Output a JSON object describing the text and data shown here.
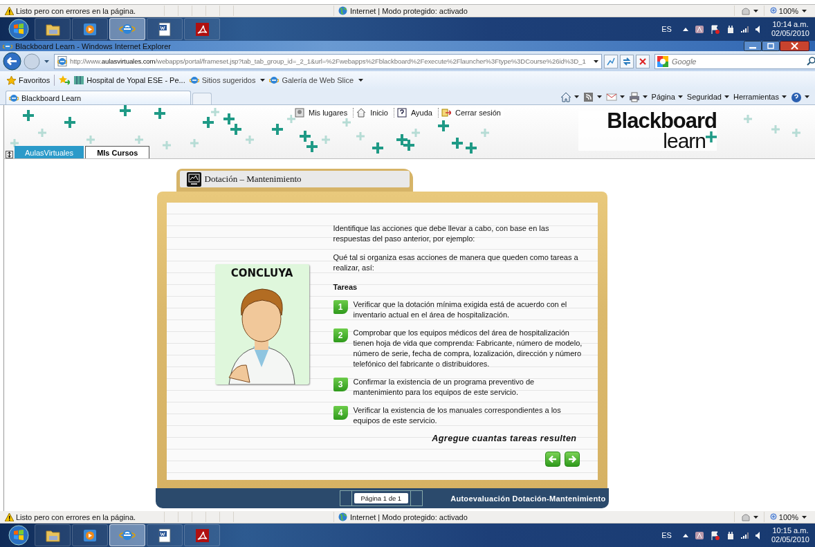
{
  "top_status_bar": {
    "message": "Listo pero con errores en la página.",
    "zone": "Internet | Modo protegido: activado",
    "zoom": "100%"
  },
  "top_taskbar": {
    "apps": [
      {
        "kind": "folder",
        "selected": false
      },
      {
        "kind": "media",
        "selected": false
      },
      {
        "kind": "browser",
        "selected": true
      },
      {
        "kind": "word",
        "selected": false
      },
      {
        "kind": "pdf",
        "selected": false
      }
    ],
    "language": "ES",
    "time": "10:14 a.m.",
    "date": "02/05/2010"
  },
  "browser": {
    "title": "Blackboard Learn - Windows Internet Explorer",
    "address": "http://www.**aulasvirtuales.com**/webapps/portal/frameset.jsp?tab_tab_group_id=_2_1&url=%2Fwebapps%2Fblackboard%2Fexecute%2Flauncher%3Ftype%3DCourse%26id%3D_1",
    "search": {
      "placeholder": "Google"
    },
    "favorites_label": "Favoritos",
    "favorites": [
      {
        "label": "Hospital de Yopal ESE - Pe...",
        "kind": "site"
      },
      {
        "label": "Sitios sugeridos",
        "kind": "menu"
      },
      {
        "label": "Galería de Web Slice",
        "kind": "menu"
      }
    ],
    "tab": {
      "label": "Blackboard Learn"
    },
    "commands": [
      "Página",
      "Seguridad",
      "Herramientas"
    ]
  },
  "portal": {
    "links": [
      {
        "label": "Mis lugares",
        "kind": "places"
      },
      {
        "label": "Inicio",
        "kind": "home"
      },
      {
        "label": "Ayuda",
        "kind": "help"
      },
      {
        "label": "Cerrar sesión",
        "kind": "logout"
      }
    ],
    "logo": {
      "top": "Blackboard",
      "bottom": "learn"
    },
    "tabs": [
      {
        "label": "AulasVirtuales",
        "selected": false
      },
      {
        "label": "MIs Cursos",
        "selected": true
      }
    ]
  },
  "lesson": {
    "title": "Dotación – Mantenimiento",
    "heading": "CONCLUYA",
    "paragraphs": [
      "Identifique las acciones que debe llevar a cabo, con base en las respuestas del paso anterior, por ejemplo:",
      "Qué tal si organiza esas acciones de manera que queden como tareas a realizar, así:"
    ],
    "tasks_heading": "Tareas",
    "tasks": [
      {
        "number": "1",
        "text": "Verificar que la dotación mínima exigida está de acuerdo con el inventario actual en el área de hospitalización."
      },
      {
        "number": "2",
        "text": "Comprobar que los equipos médicos del área de hospitalización tienen hoja de vida que comprenda: Fabricante, número de modelo, número de serie, fecha de compra, lozalización, dirección y número telefónico del fabricante o distribuidores."
      },
      {
        "number": "3",
        "text": "Confirmar la existencia de un programa preventivo de mantenimiento para los equipos de este servicio."
      },
      {
        "number": "4",
        "text": "Verificar la existencia de los manuales correspondientes a los equipos de este servicio."
      }
    ],
    "closing": "Agregue cuantas tareas resulten",
    "page_label": "Página 1 de 1",
    "footer_title": "Autoevaluación Dotación-Mantenimiento"
  },
  "bottom_status_bar": {
    "message": "Listo pero con errores en la página.",
    "zone": "Internet | Modo protegido: activado",
    "zoom": "100%"
  },
  "bottom_taskbar": {
    "apps": [
      {
        "kind": "folder",
        "selected": false
      },
      {
        "kind": "media",
        "selected": false
      },
      {
        "kind": "browser",
        "selected": true
      },
      {
        "kind": "word",
        "selected": false
      },
      {
        "kind": "pdf",
        "selected": false
      }
    ],
    "language": "ES",
    "time": "10:15 a.m.",
    "date": "02/05/2010"
  }
}
